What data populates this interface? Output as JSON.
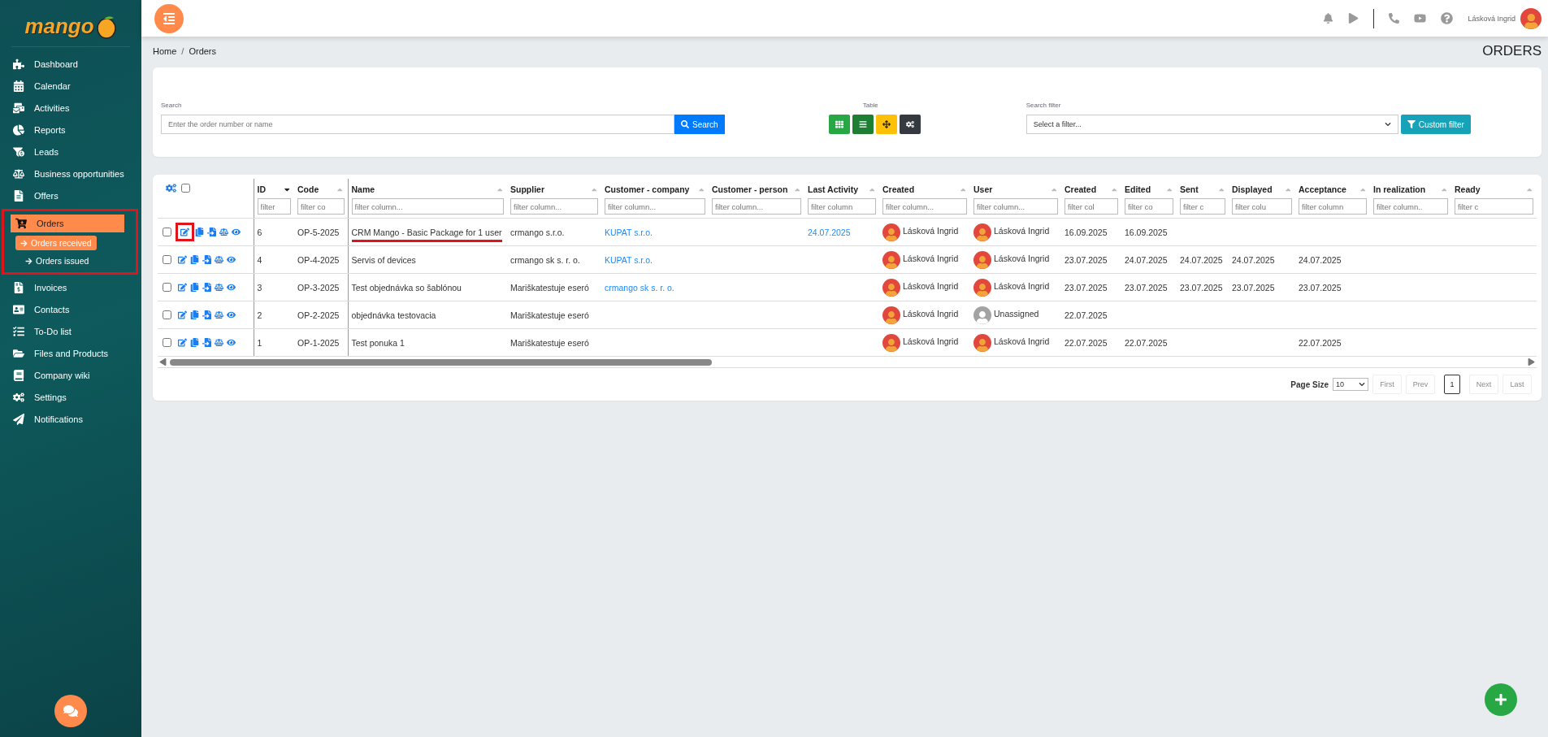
{
  "sidebar": {
    "logo": "mango",
    "items": [
      {
        "label": "Dashboard",
        "selected": false
      },
      {
        "label": "Calendar",
        "selected": false
      },
      {
        "label": "Activities",
        "selected": false
      },
      {
        "label": "Reports",
        "selected": false
      },
      {
        "label": "Leads",
        "selected": false
      },
      {
        "label": "Business opportunities",
        "selected": false
      },
      {
        "label": "Offers",
        "selected": false
      },
      {
        "label": "Orders",
        "selected": true,
        "highlighted": true,
        "children": [
          {
            "label": "Orders received",
            "selected": true
          },
          {
            "label": "Orders issued",
            "selected": false
          }
        ]
      },
      {
        "label": "Invoices",
        "selected": false
      },
      {
        "label": "Contacts",
        "selected": false
      },
      {
        "label": "To-Do list",
        "selected": false
      },
      {
        "label": "Files and Products",
        "selected": false
      },
      {
        "label": "Company wiki",
        "selected": false
      },
      {
        "label": "Settings",
        "selected": false
      },
      {
        "label": "Notifications",
        "selected": false
      }
    ]
  },
  "topbar": {
    "user_name": "Lásková Ingrid"
  },
  "breadcrumb": {
    "items": [
      "Home",
      "Orders"
    ],
    "separator": "/"
  },
  "page_title": "ORDERS",
  "search": {
    "label": "Search",
    "placeholder": "Enter the order number or name",
    "button": "Search"
  },
  "table_view": {
    "label": "Table"
  },
  "search_filter": {
    "label": "Search filter",
    "value": "Select a filter...",
    "button": "Custom filter"
  },
  "table": {
    "select_all": false,
    "columns": [
      {
        "label": "ID",
        "placeholder": "filter",
        "sorted": true
      },
      {
        "label": "Code",
        "placeholder": "filter co",
        "sorted": false
      },
      {
        "label": "Name",
        "placeholder": "filter column...",
        "sorted": false
      },
      {
        "label": "Supplier",
        "placeholder": "filter column...",
        "sorted": false
      },
      {
        "label": "Customer - company",
        "placeholder": "filter column...",
        "sorted": false
      },
      {
        "label": "Customer - person",
        "placeholder": "filter column...",
        "sorted": false
      },
      {
        "label": "Last Activity",
        "placeholder": "filter column",
        "sorted": false
      },
      {
        "label": "Created",
        "placeholder": "filter column...",
        "sorted": false
      },
      {
        "label": "User",
        "placeholder": "filter column...",
        "sorted": false
      },
      {
        "label": "Created",
        "placeholder": "filter col",
        "sorted": false
      },
      {
        "label": "Edited",
        "placeholder": "filter co",
        "sorted": false
      },
      {
        "label": "Sent",
        "placeholder": "filter c",
        "sorted": false
      },
      {
        "label": "Displayed",
        "placeholder": "filter colu",
        "sorted": false
      },
      {
        "label": "Acceptance",
        "placeholder": "filter column",
        "sorted": false
      },
      {
        "label": "In realization",
        "placeholder": "filter column..",
        "sorted": false
      },
      {
        "label": "Ready",
        "placeholder": "filter c",
        "sorted": false
      }
    ],
    "rows": [
      {
        "checked": false,
        "edit_highlighted": true,
        "name_underlined": true,
        "id": "6",
        "code": "OP-5-2025",
        "name": "CRM Mango - Basic Package for 1 user",
        "supplier": "crmango s.r.o.",
        "customer_company": "KUPAT s.r.o.",
        "last_activity": "24.07.2025",
        "creator": "Lásková Ingrid",
        "user": "Lásková Ingrid",
        "user_assigned": true,
        "created": "16.09.2025",
        "edited": "16.09.2025"
      },
      {
        "checked": false,
        "edit_highlighted": false,
        "name_underlined": false,
        "id": "4",
        "code": "OP-4-2025",
        "name": "Servis of devices",
        "supplier": "crmango sk s. r. o.",
        "customer_company": "KUPAT s.r.o.",
        "creator": "Lásková Ingrid",
        "user": "Lásková Ingrid",
        "user_assigned": true,
        "created": "23.07.2025",
        "edited": "24.07.2025",
        "sent": "24.07.2025",
        "displayed": "24.07.2025",
        "acceptance": "24.07.2025"
      },
      {
        "checked": false,
        "edit_highlighted": false,
        "name_underlined": false,
        "id": "3",
        "code": "OP-3-2025",
        "name": "Test objednávka so šablónou",
        "supplier": "Mariškatestuje eseró",
        "customer_company": "crmango sk s. r. o.",
        "creator": "Lásková Ingrid",
        "user": "Lásková Ingrid",
        "user_assigned": true,
        "created": "23.07.2025",
        "edited": "23.07.2025",
        "sent": "23.07.2025",
        "displayed": "23.07.2025",
        "acceptance": "23.07.2025"
      },
      {
        "checked": false,
        "edit_highlighted": false,
        "name_underlined": false,
        "id": "2",
        "code": "OP-2-2025",
        "name": "objednávka testovacia",
        "supplier": "Mariškatestuje eseró",
        "creator": "Lásková Ingrid",
        "user": "Unassigned",
        "user_assigned": false,
        "created": "22.07.2025"
      },
      {
        "checked": false,
        "edit_highlighted": false,
        "name_underlined": false,
        "id": "1",
        "code": "OP-1-2025",
        "name": "Test ponuka 1",
        "supplier": "Mariškatestuje eseró",
        "creator": "Lásková Ingrid",
        "user": "Lásková Ingrid",
        "user_assigned": true,
        "created": "22.07.2025",
        "edited": "22.07.2025",
        "acceptance": "22.07.2025"
      }
    ]
  },
  "pagination": {
    "page_size_label": "Page Size",
    "page_size": "10",
    "first": "First",
    "prev": "Prev",
    "pages": [
      {
        "label": "1",
        "selected": true
      }
    ],
    "next": "Next",
    "last": "Last"
  }
}
